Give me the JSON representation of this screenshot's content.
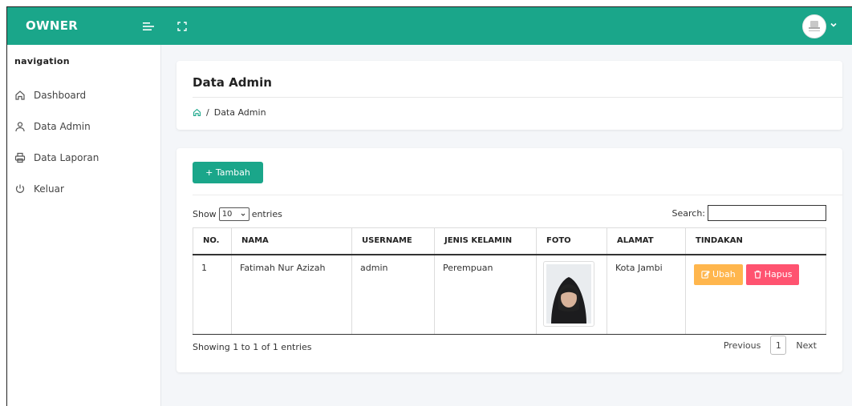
{
  "topbar": {
    "brand": "OWNER",
    "menu_icon": "menu-toggle-icon",
    "fullscreen_icon": "fullscreen-icon",
    "avatar_icon": "user-avatar",
    "caret_icon": "chevron-down-icon"
  },
  "sidebar": {
    "caption": "navigation",
    "items": [
      {
        "label": "Dashboard",
        "icon": "home-icon"
      },
      {
        "label": "Data Admin",
        "icon": "user-icon"
      },
      {
        "label": "Data Laporan",
        "icon": "printer-icon"
      },
      {
        "label": "Keluar",
        "icon": "power-icon"
      }
    ]
  },
  "header": {
    "title": "Data Admin",
    "breadcrumb_sep": "/",
    "breadcrumb_current": "Data Admin"
  },
  "table_card": {
    "add_button": "+ Tambah",
    "show_label": "Show",
    "entries_value": "10",
    "entries_label": "entries",
    "search_label": "Search:",
    "search_value": "",
    "columns": [
      "NO.",
      "NAMA",
      "USERNAME",
      "JENIS KELAMIN",
      "FOTO",
      "ALAMAT",
      "TINDAKAN"
    ],
    "rows": [
      {
        "no": "1",
        "nama": "Fatimah Nur Azizah",
        "username": "admin",
        "jenis_kelamin": "Perempuan",
        "alamat": "Kota Jambi"
      }
    ],
    "edit_label": "Ubah",
    "delete_label": "Hapus",
    "info": "Showing 1 to 1 of 1 entries",
    "pagination": {
      "previous": "Previous",
      "page": "1",
      "next": "Next"
    }
  },
  "colors": {
    "primary": "#1aa68a",
    "warning": "#ffb64d",
    "danger": "#ff5370",
    "background": "#f4f6f9"
  }
}
